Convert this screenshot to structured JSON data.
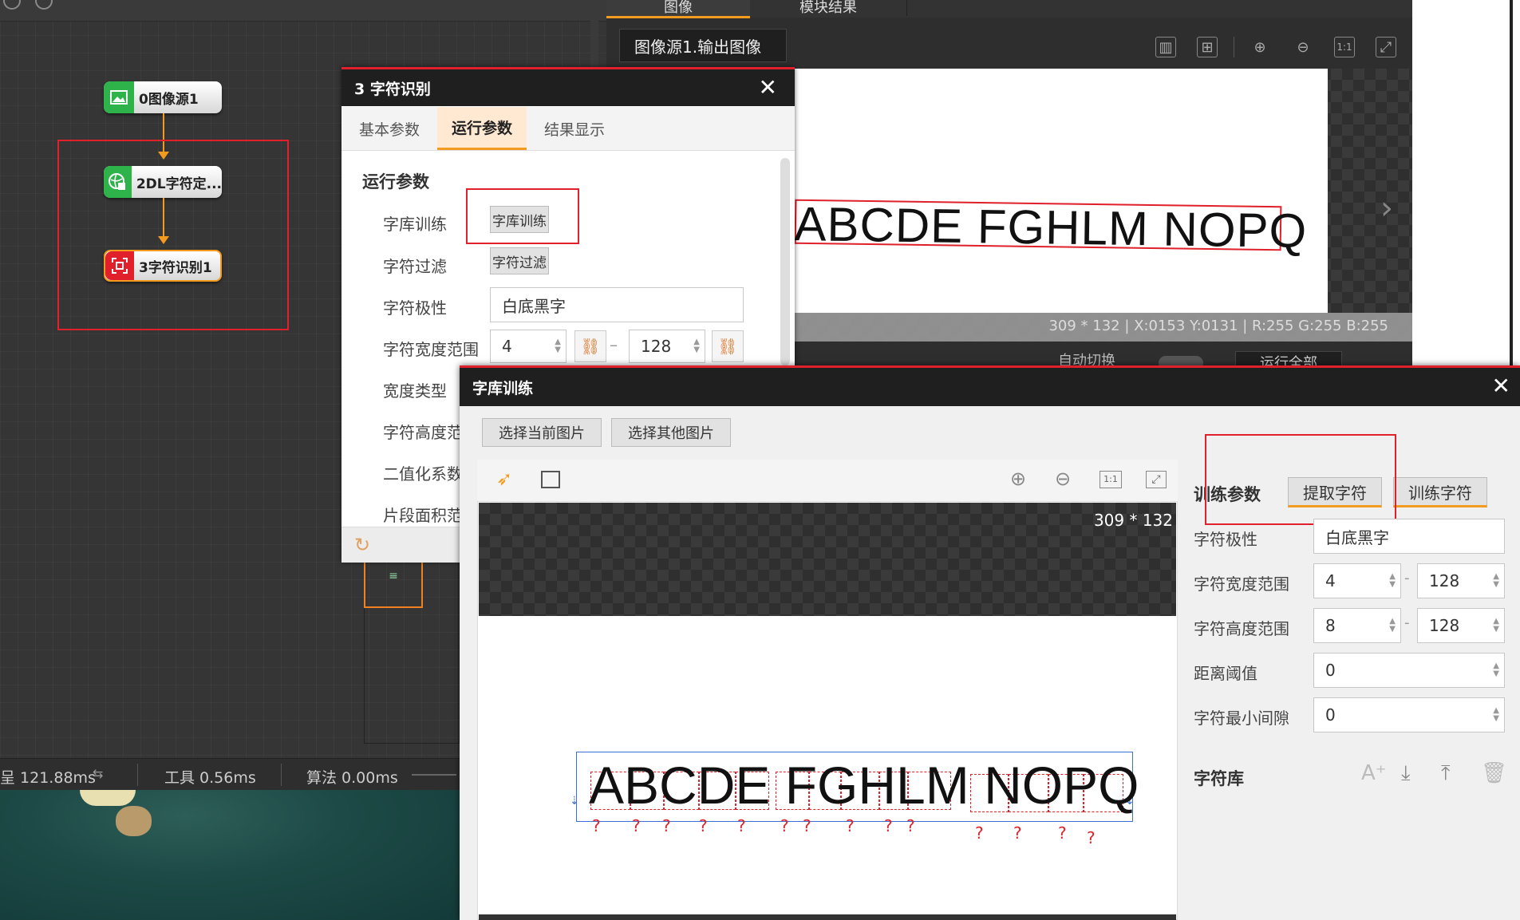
{
  "workflow": {
    "nodes": [
      {
        "label": "0图像源1"
      },
      {
        "label": "2DL字符定..."
      },
      {
        "label": "3字符识别1"
      }
    ],
    "status": {
      "total": "121.88ms",
      "tool": "工具 0.56ms",
      "algo": "算法 0.00ms"
    }
  },
  "image_panel": {
    "tabs": [
      "图像",
      "模块结果"
    ],
    "source_select": "图像源1.输出图像",
    "preview_text": "ABCDE FGHLM NOPQ",
    "info_bar": "309 * 132 | X:0153 Y:0131 | R:255 G:255 B:255",
    "auto_switch_label": "自动切换",
    "run_all_label": "运行全部"
  },
  "ocr_dialog": {
    "title": "3 字符识别",
    "tabs": [
      "基本参数",
      "运行参数",
      "结果显示"
    ],
    "active_tab": "运行参数",
    "section_title": "运行参数",
    "rows": {
      "lib_train_label": "字库训练",
      "lib_train_btn": "字库训练",
      "filter_label": "字符过滤",
      "filter_btn": "字符过滤",
      "polarity_label": "字符极性",
      "polarity_value": "白底黑字",
      "width_label": "字符宽度范围",
      "width_min": "4",
      "width_max": "128",
      "width_type_label": "宽度类型",
      "height_label": "字符高度范",
      "binarize_label": "二值化系数",
      "segment_label": "片段面积范"
    }
  },
  "train_dialog": {
    "title": "字库训练",
    "select_current": "选择当前图片",
    "select_other": "选择其他图片",
    "image_size": "309 * 132",
    "train_text": "ABCDE FGHLM NOPQ",
    "qmark": "?",
    "params_title": "训练参数",
    "extract_btn": "提取字符",
    "train_btn": "训练字符",
    "polarity_label": "字符极性",
    "polarity_value": "白底黑字",
    "width_label": "字符宽度范围",
    "width_min": "4",
    "width_max": "128",
    "height_label": "字符高度范围",
    "height_min": "8",
    "height_max": "128",
    "dist_label": "距离阈值",
    "dist_value": "0",
    "gap_label": "字符最小间隙",
    "gap_value": "0",
    "library_title": "字符库"
  },
  "colors": {
    "accent": "#f29b1e",
    "highlight_red": "#e0202a",
    "node_green": "#2db34a",
    "node_red": "#e0202a"
  }
}
